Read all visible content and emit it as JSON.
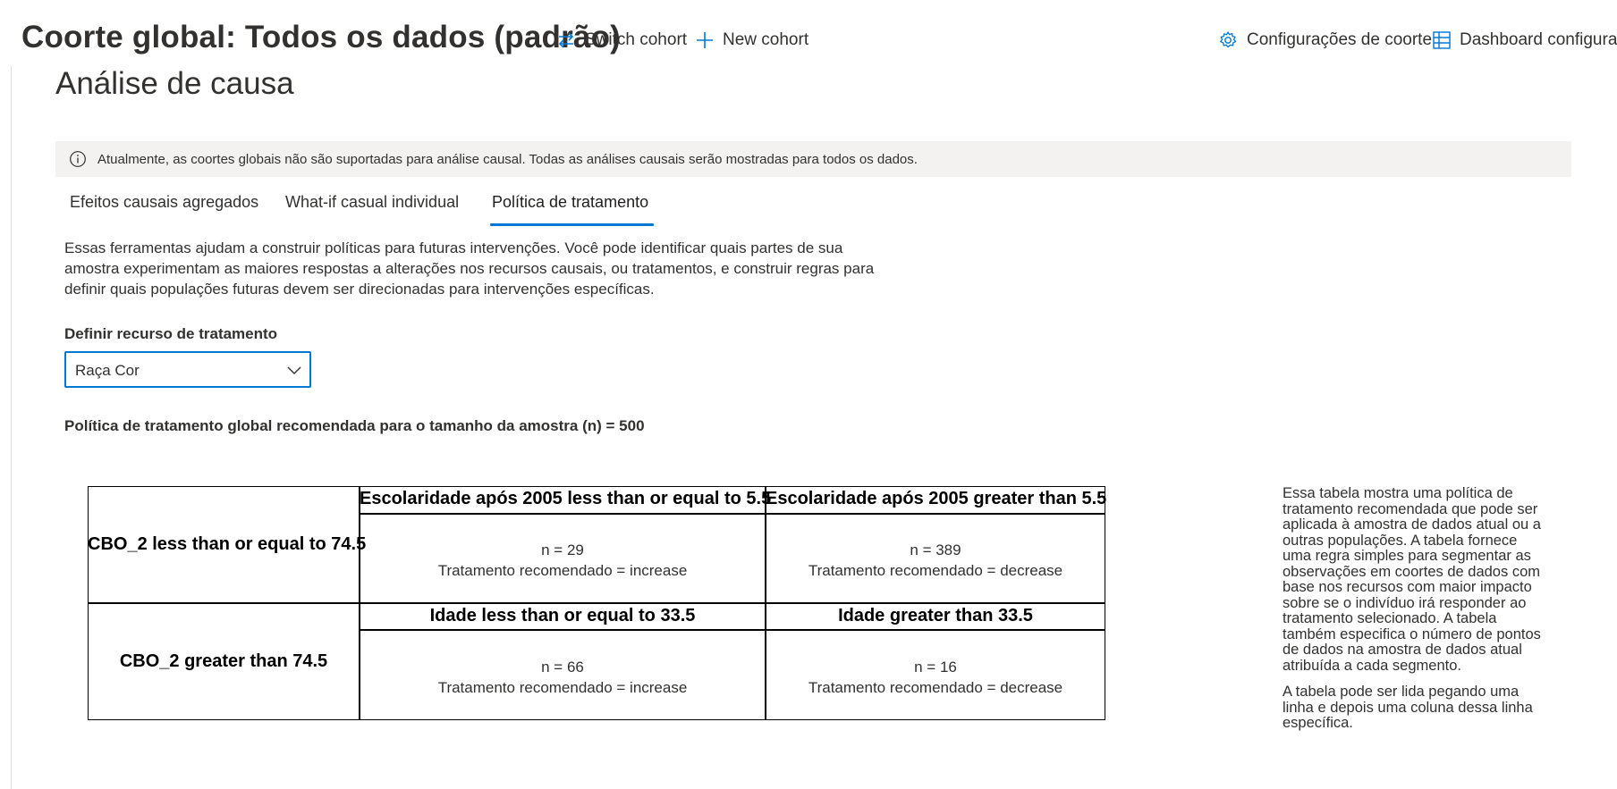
{
  "header": {
    "cohort_title": "Coorte global: Todos os dados (padrão)",
    "switch_cohort": "Switch cohort",
    "new_cohort": "New cohort",
    "cohort_settings": "Configurações de coorte",
    "dashboard_config": "Dashboard configuratio"
  },
  "section": {
    "title": "Análise de causa"
  },
  "info_banner": {
    "text": "Atualmente, as coortes globais não são suportadas para análise causal. Todas as análises causais serão mostradas para todos os dados."
  },
  "tabs": [
    {
      "label": "Efeitos causais agregados",
      "selected": false
    },
    {
      "label": "What-if casual individual",
      "selected": false
    },
    {
      "label": "Política de tratamento",
      "selected": true
    }
  ],
  "description": "Essas ferramentas ajudam a construir políticas para futuras intervenções. Você pode identificar quais partes de sua amostra experimentam as maiores respostas a alterações nos recursos causais, ou tratamentos, e construir regras para definir quais populações futuras devem ser direcionadas para intervenções específicas.",
  "treatment_feature": {
    "label": "Definir recurso de tratamento",
    "selected": "Raça Cor"
  },
  "policy": {
    "heading": "Política de tratamento global recomendada para o tamanho da amostra (n) = 500",
    "rows": [
      {
        "label": "CBO_2 less than or equal to 74.5",
        "columns": [
          {
            "header": "Escolaridade após 2005 less than or equal to 5.5",
            "n": "n = 29",
            "treatment": "Tratamento recomendado = increase"
          },
          {
            "header": "Escolaridade após 2005 greater than 5.5",
            "n": "n = 389",
            "treatment": "Tratamento recomendado = decrease"
          }
        ]
      },
      {
        "label": "CBO_2 greater than 74.5",
        "columns": [
          {
            "header": "Idade less than or equal to 33.5",
            "n": "n = 66",
            "treatment": "Tratamento recomendado = increase"
          },
          {
            "header": "Idade greater than 33.5",
            "n": "n = 16",
            "treatment": "Tratamento recomendado = decrease"
          }
        ]
      }
    ]
  },
  "side_note": {
    "p1": "Essa tabela mostra uma política de tratamento recomendada que pode ser aplicada à amostra de dados atual ou a outras populações. A tabela fornece uma regra simples para segmentar as observações em coortes de dados com base nos recursos com maior impacto sobre se o indivíduo irá responder ao tratamento selecionado. A tabela também especifica o número de pontos de dados na amostra de dados atual atribuída a cada segmento.",
    "p2": "A tabela pode ser lida pegando uma linha e depois uma coluna dessa linha específica."
  },
  "colors": {
    "accent": "#0078d4",
    "banner_bg": "#f3f2f1",
    "text": "#323130"
  },
  "icons": [
    "switch-icon",
    "plus-icon",
    "gear-icon",
    "table-icon",
    "info-icon",
    "chevron-down-icon"
  ]
}
